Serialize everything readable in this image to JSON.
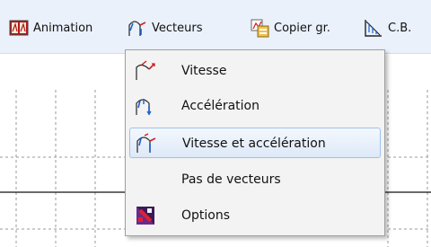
{
  "toolbar": {
    "animation_label": "Animation",
    "vecteurs_label": "Vecteurs",
    "copier_label": "Copier gr.",
    "cb_label": "C.B."
  },
  "menu": {
    "items": [
      {
        "label": "Vitesse",
        "icon": "velocity-vector-icon"
      },
      {
        "label": "Accélération",
        "icon": "acceleration-vector-icon"
      },
      {
        "label": "Vitesse et accélération",
        "icon": "velocity-acceleration-icon",
        "highlighted": true
      },
      {
        "label": "Pas de vecteurs",
        "icon": ""
      },
      {
        "label": "Options",
        "icon": "options-icon"
      }
    ]
  }
}
